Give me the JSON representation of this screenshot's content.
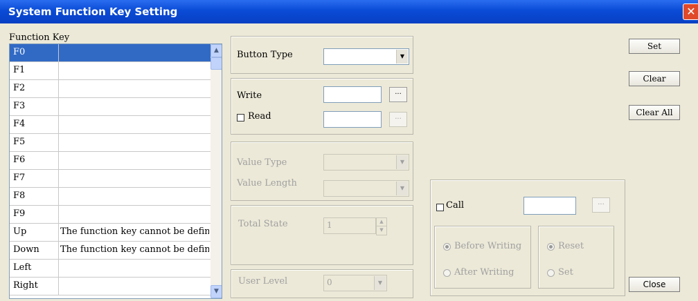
{
  "window": {
    "title": "System Function Key Setting",
    "close_glyph": "✕"
  },
  "function_key": {
    "label": "Function Key",
    "rows": [
      {
        "key": "F0",
        "desc": ""
      },
      {
        "key": "F1",
        "desc": ""
      },
      {
        "key": "F2",
        "desc": ""
      },
      {
        "key": "F3",
        "desc": ""
      },
      {
        "key": "F4",
        "desc": ""
      },
      {
        "key": "F5",
        "desc": ""
      },
      {
        "key": "F6",
        "desc": ""
      },
      {
        "key": "F7",
        "desc": ""
      },
      {
        "key": "F8",
        "desc": ""
      },
      {
        "key": "F9",
        "desc": ""
      },
      {
        "key": "Up",
        "desc": "The function key cannot be define"
      },
      {
        "key": "Down",
        "desc": "The function key cannot be define"
      },
      {
        "key": "Left",
        "desc": ""
      },
      {
        "key": "Right",
        "desc": ""
      }
    ],
    "selected_index": 0
  },
  "button_type": {
    "label": "Button Type",
    "value": ""
  },
  "write": {
    "label": "Write",
    "value": "",
    "browse": "..."
  },
  "read": {
    "label": "Read",
    "checked": false,
    "value": "",
    "browse": "..."
  },
  "value_type": {
    "label": "Value Type",
    "value": ""
  },
  "value_length": {
    "label": "Value Length",
    "value": ""
  },
  "total_state": {
    "label": "Total State",
    "value": "1"
  },
  "user_level": {
    "label": "User Level",
    "value": "0"
  },
  "call": {
    "label": "Call",
    "checked": false,
    "value": "",
    "browse": "...",
    "before_writing": "Before Writing",
    "after_writing": "After Writing",
    "timing_selected": "Before Writing",
    "reset": "Reset",
    "set": "Set",
    "mode_selected": "Reset"
  },
  "buttons": {
    "set": "Set",
    "clear": "Clear",
    "clear_all": "Clear All",
    "close": "Close"
  },
  "icons": {
    "arrow_up": "▲",
    "arrow_down": "▼",
    "dropdown": "▼"
  }
}
